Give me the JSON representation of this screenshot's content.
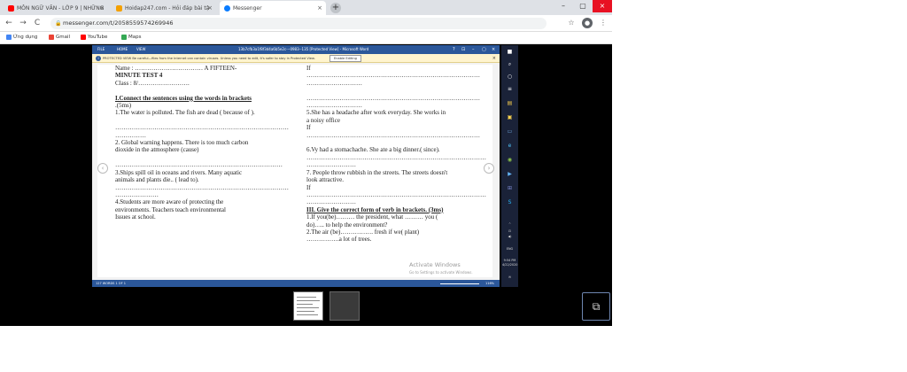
{
  "tabs": [
    {
      "title": "MÔN NGỮ VĂN - LỚP 9 | NHỮNG",
      "close": "×",
      "color": "#ff0000"
    },
    {
      "title": "Hoidap247.com - Hỏi đáp bài tậ",
      "close": "×",
      "color": "#f4a000"
    },
    {
      "title": "Messenger",
      "close": "×",
      "color": "#0a7cff"
    }
  ],
  "new_tab": "+",
  "window_controls": {
    "minimize": "–",
    "maximize": "▢",
    "close": "×"
  },
  "nav": {
    "back": "←",
    "forward": "→",
    "reload": "C"
  },
  "address": {
    "lock": "🔒",
    "url": "messenger.com/t/2058559574269946"
  },
  "address_icons": {
    "star": "☆",
    "avatar": "●",
    "menu": "⋮"
  },
  "bookmarks": [
    {
      "label": "Ứng dụng",
      "color": "#4285f4"
    },
    {
      "label": "Gmail",
      "color": "#ea4335"
    },
    {
      "label": "YouTube",
      "color": "#ff0000"
    },
    {
      "label": "Maps",
      "color": "#34a853"
    }
  ],
  "word": {
    "ribbon_tabs": [
      "FILE",
      "HOME",
      "VIEW"
    ],
    "doc_title": "13b7cfb3a1f8f3d4a6b5e2c---0983--135 [Protected View] - Microsoft Word",
    "controls": [
      "?",
      "⊡",
      "–",
      "▢",
      "×"
    ],
    "protected_msg": "PROTECTED VIEW  Be careful—files from the Internet can contain viruses. Unless you need to edit, it's safer to stay in Protected View.",
    "enable_editing": "Enable Editing",
    "pv_close": "×",
    "status_left": "127 WORDS  1 OF 1",
    "status_zoom": "116%",
    "watermark_title": "Activate Windows",
    "watermark_sub": "Go to Settings to activate Windows."
  },
  "document": {
    "left": [
      "Name : ……………………………      A FIFTEEN-",
      "MINUTE TEST 4",
      "Class  : 8/…………………….",
      "",
      "I.Connect the sentences using the words in brackets",
      " .(5ms)",
      "1.The water is  polluted. The fish are dead ( because of ).",
      "",
      "…………………………………………………………………………",
      "……………",
      "2. Global warning happens. There is too much carbon",
      "dioxide in the atmosphere (cause)",
      "",
      "………………………………………………………………………",
      "3.Ships spill oil in oceans and rivers. Many aquatic",
      "animals and plants die.. ( lead to).",
      "…………………………………………………………………………",
      "…………………",
      "4.Students are more aware of protecting the",
      "environments. Teachers teach environmental",
      " Issues at school."
    ],
    "right": [
      "    If",
      "…………………………………………………………………………",
      "………………………",
      "",
      "…………………………………………………………………………",
      "………………………",
      "5.She has a headache after work everyday. She works in",
      "a noisy office",
      "If",
      "…………………………………………………………………………",
      "",
      "6.Vy had a stomachache. She ate a big dinner.( since).",
      "……………………………………………………………………………",
      "……………………",
      "7. People throw rubbish in the streets. The streets doesn't",
      "look attractive.",
      "If",
      "……………………………………………………………………………",
      "……………………",
      "III. Give the correct form of verb in brackets. (3ms)",
      "1.If you(be)……… the president, what ……… you (",
      "do)….. to help the environment?",
      "2.The air (be)……………. fresh if we( plant)",
      "…………….a lot of trees."
    ],
    "underlined_left": [
      4
    ],
    "underlined_right": [
      19
    ],
    "bold_left": [
      1
    ]
  },
  "taskbar": {
    "icons": [
      "■",
      "⌕",
      "○",
      "≡",
      "▤",
      "▣",
      "▭",
      "e",
      "◉",
      "▶",
      "⊞",
      "S"
    ],
    "time": "9:54 PM",
    "date": "4/22/2020",
    "lang": "ENG",
    "tray": [
      "^",
      "⊡",
      "◀)",
      "✉"
    ]
  },
  "viewer": {
    "prev": "‹",
    "next": "›",
    "gallery": "⧉"
  }
}
